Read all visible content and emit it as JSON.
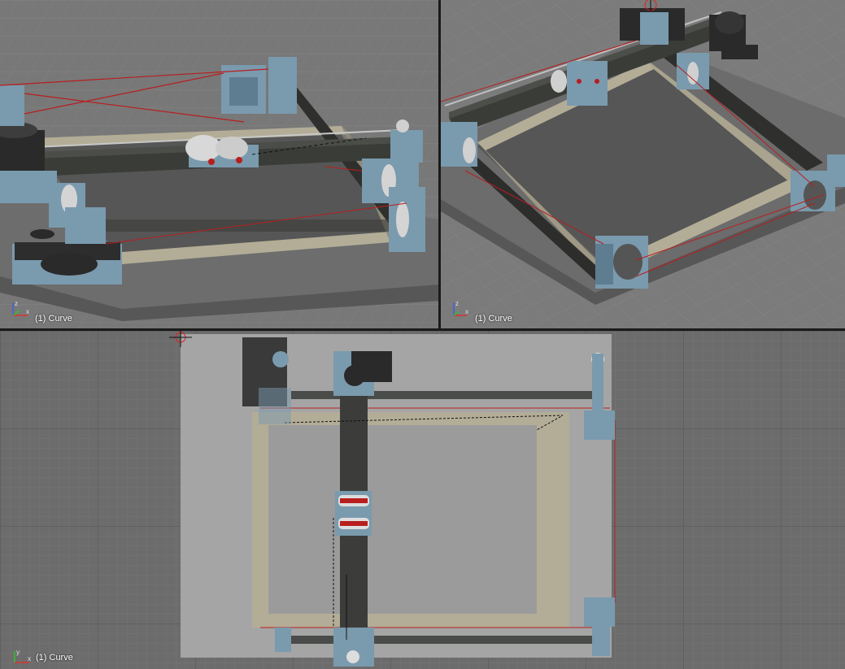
{
  "viewports": {
    "persp_left": {
      "label": "(1) Curve"
    },
    "persp_right": {
      "label": "(1) Curve"
    },
    "top": {
      "label": "(1) Curve"
    }
  },
  "axis_icon": {
    "x": "x",
    "y": "y",
    "z": "z"
  },
  "colors": {
    "background_grid": "#6e6e6e",
    "grid_line": "#7a7a7a",
    "base_plate": "#a5a5a5",
    "frame_tan": "#b3ad97",
    "rail_dark": "#3c3f3c",
    "bracket_blue": "#7a9aae",
    "motor_dark": "#2a2a2a",
    "string_red": "#b81e1e"
  }
}
